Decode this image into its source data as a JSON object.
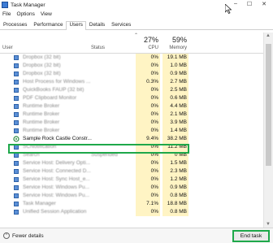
{
  "window": {
    "title": "Task Manager",
    "controls": [
      "–",
      "☐",
      "✕"
    ]
  },
  "menu": [
    "File",
    "Options",
    "View"
  ],
  "tabs": [
    "Processes",
    "Performance",
    "Users",
    "Details",
    "Services"
  ],
  "active_tab": "Users",
  "header": {
    "user_label": "User",
    "status_label": "Status",
    "cpu_pct": "27%",
    "cpu_label": "CPU",
    "mem_pct": "59%",
    "mem_label": "Memory"
  },
  "rows": [
    {
      "name": "Dropbox (32 bit)",
      "status": "",
      "cpu": "0%",
      "mem": "19.1 MB"
    },
    {
      "name": "Dropbox (32 bit)",
      "status": "",
      "cpu": "0%",
      "mem": "1.0 MB"
    },
    {
      "name": "Dropbox (32 bit)",
      "status": "",
      "cpu": "0%",
      "mem": "0.9 MB"
    },
    {
      "name": "Host Process for Windows ...",
      "status": "",
      "cpu": "0.3%",
      "mem": "2.7 MB"
    },
    {
      "name": "QuickBooks FAUP (32 bit)",
      "status": "",
      "cpu": "0%",
      "mem": "2.5 MB"
    },
    {
      "name": "PDF Clipboard Monitor",
      "status": "",
      "cpu": "0%",
      "mem": "0.6 MB"
    },
    {
      "name": "Runtime Broker",
      "status": "",
      "cpu": "0%",
      "mem": "4.4 MB"
    },
    {
      "name": "Runtime Broker",
      "status": "",
      "cpu": "0%",
      "mem": "2.1 MB"
    },
    {
      "name": "Runtime Broker",
      "status": "",
      "cpu": "0%",
      "mem": "3.9 MB"
    },
    {
      "name": "Runtime Broker",
      "status": "",
      "cpu": "0%",
      "mem": "1.4 MB"
    },
    {
      "name": "Sample Rock Castle Constr...",
      "status": "",
      "cpu": "9.4%",
      "mem": "38.2 MB",
      "highlight": true
    },
    {
      "name": "SCNotification",
      "status": "",
      "cpu": "0%",
      "mem": "11.2 MB"
    },
    {
      "name": "Search",
      "status": "Suspended",
      "cpu": "0%",
      "mem": "0 MB"
    },
    {
      "name": "Service Host: Delivery Opti...",
      "status": "",
      "cpu": "0%",
      "mem": "1.5 MB"
    },
    {
      "name": "Service Host: Connected D...",
      "status": "",
      "cpu": "0%",
      "mem": "2.3 MB"
    },
    {
      "name": "Service Host: Sync Host_e...",
      "status": "",
      "cpu": "0%",
      "mem": "1.2 MB"
    },
    {
      "name": "Service Host: Windows Pu...",
      "status": "",
      "cpu": "0%",
      "mem": "0.9 MB"
    },
    {
      "name": "Service Host: Windows Pu...",
      "status": "",
      "cpu": "0%",
      "mem": "0.8 MB"
    },
    {
      "name": "Task Manager",
      "status": "",
      "cpu": "7.1%",
      "mem": "18.8 MB"
    },
    {
      "name": "Unified Session Application",
      "status": "",
      "cpu": "0%",
      "mem": "0.8 MB"
    }
  ],
  "footer": {
    "fewer_details": "Fewer details",
    "end_task": "End task"
  }
}
